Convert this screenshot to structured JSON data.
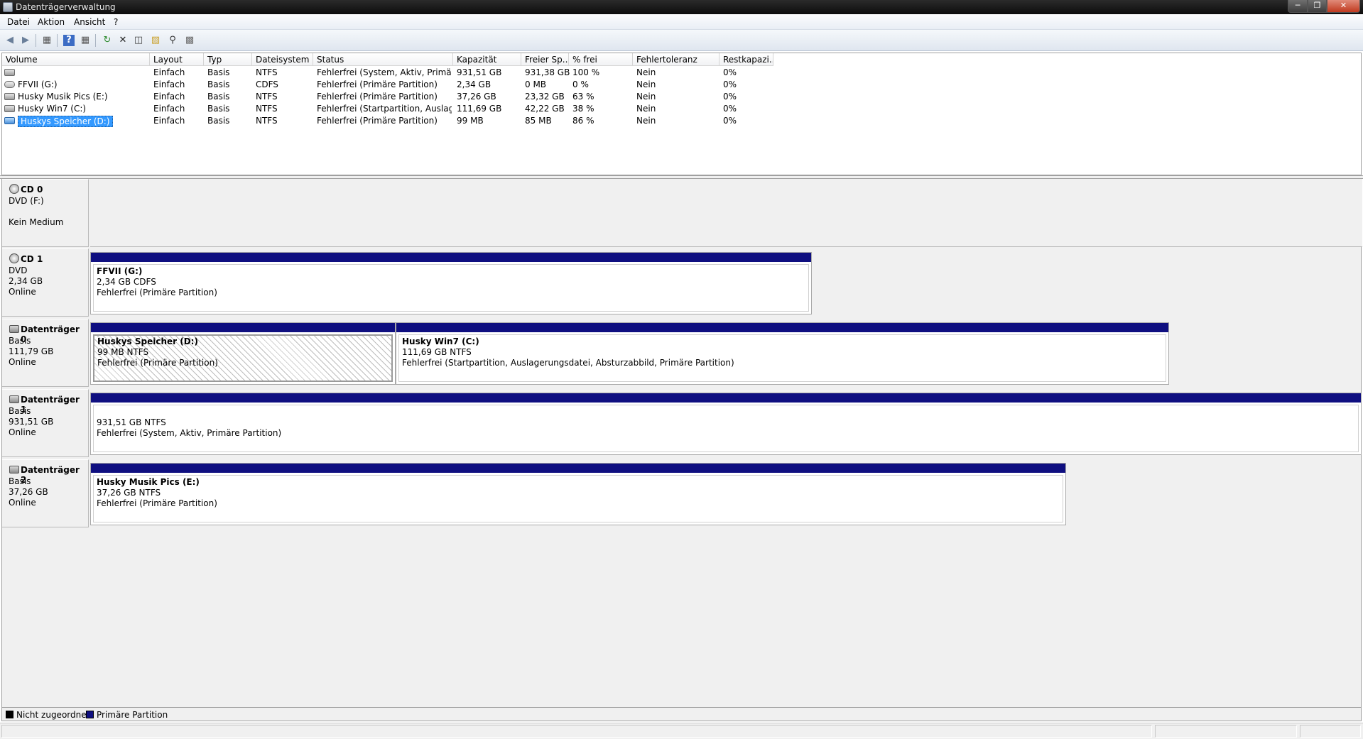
{
  "window": {
    "title": "Datenträgerverwaltung"
  },
  "menu": [
    "Datei",
    "Aktion",
    "Ansicht",
    "?"
  ],
  "toolbar": {
    "icons": [
      "back-arrow-icon",
      "forward-arrow-icon",
      "console-tree-icon",
      "help-icon",
      "properties-icon",
      "refresh-icon",
      "delete-icon",
      "export-list-icon",
      "open-folder-icon",
      "search-icon",
      "rescan-disks-icon"
    ]
  },
  "volume_list": {
    "columns": [
      "Volume",
      "Layout",
      "Typ",
      "Dateisystem",
      "Status",
      "Kapazität",
      "Freier Sp...",
      "% frei",
      "Fehlertoleranz",
      "Restkapazi..."
    ],
    "rows": [
      {
        "volume": "",
        "icon": "disk",
        "layout": "Einfach",
        "typ": "Basis",
        "fs": "NTFS",
        "status": "Fehlerfrei (System, Aktiv, Primäre...",
        "capacity": "931,51 GB",
        "free": "931,38 GB",
        "pct": "100 %",
        "ft": "Nein",
        "overhead": "0%"
      },
      {
        "volume": "FFVII (G:)",
        "icon": "cd",
        "layout": "Einfach",
        "typ": "Basis",
        "fs": "CDFS",
        "status": "Fehlerfrei (Primäre Partition)",
        "capacity": "2,34 GB",
        "free": "0 MB",
        "pct": "0 %",
        "ft": "Nein",
        "overhead": "0%"
      },
      {
        "volume": "Husky Musik Pics (E:)",
        "icon": "disk",
        "layout": "Einfach",
        "typ": "Basis",
        "fs": "NTFS",
        "status": "Fehlerfrei (Primäre Partition)",
        "capacity": "37,26 GB",
        "free": "23,32 GB",
        "pct": "63 %",
        "ft": "Nein",
        "overhead": "0%"
      },
      {
        "volume": "Husky Win7 (C:)",
        "icon": "disk",
        "layout": "Einfach",
        "typ": "Basis",
        "fs": "NTFS",
        "status": "Fehlerfrei (Startpartition, Auslage...",
        "capacity": "111,69 GB",
        "free": "42,22 GB",
        "pct": "38 %",
        "ft": "Nein",
        "overhead": "0%"
      },
      {
        "volume": "Huskys Speicher (D:)",
        "icon": "disk",
        "layout": "Einfach",
        "typ": "Basis",
        "fs": "NTFS",
        "status": "Fehlerfrei (Primäre Partition)",
        "capacity": "99 MB",
        "free": "85 MB",
        "pct": "86 %",
        "ft": "Nein",
        "overhead": "0%"
      }
    ]
  },
  "disks": [
    {
      "name": "CD 0",
      "line1": "DVD (F:)",
      "line2": "",
      "line3": "Kein Medium"
    },
    {
      "name": "CD 1",
      "line1": "DVD",
      "line2": "2,34 GB",
      "line3": "Online",
      "partitions": [
        {
          "title": "FFVII  (G:)",
          "size": "2,34 GB CDFS",
          "status": "Fehlerfrei (Primäre Partition)"
        }
      ]
    },
    {
      "name": "Datenträger 0",
      "line1": "Basis",
      "line2": "111,79 GB",
      "line3": "Online",
      "partitions": [
        {
          "title": "Huskys Speicher  (D:)",
          "size": "99 MB NTFS",
          "status": "Fehlerfrei (Primäre Partition)"
        },
        {
          "title": "Husky Win7  (C:)",
          "size": "111,69 GB NTFS",
          "status": "Fehlerfrei (Startpartition, Auslagerungsdatei, Absturzabbild, Primäre Partition)"
        }
      ]
    },
    {
      "name": "Datenträger 1",
      "line1": "Basis",
      "line2": "931,51 GB",
      "line3": "Online",
      "partitions": [
        {
          "title": "",
          "size": "931,51 GB NTFS",
          "status": "Fehlerfrei (System, Aktiv, Primäre Partition)"
        }
      ]
    },
    {
      "name": "Datenträger 2",
      "line1": "Basis",
      "line2": "37,26 GB",
      "line3": "Online",
      "partitions": [
        {
          "title": "Husky Musik Pics  (E:)",
          "size": "37,26 GB NTFS",
          "status": "Fehlerfrei (Primäre Partition)"
        }
      ]
    }
  ],
  "legend": [
    {
      "label": "Nicht zugeordnet",
      "color": "#000000"
    },
    {
      "label": "Primäre Partition",
      "color": "#0f0f80"
    }
  ]
}
